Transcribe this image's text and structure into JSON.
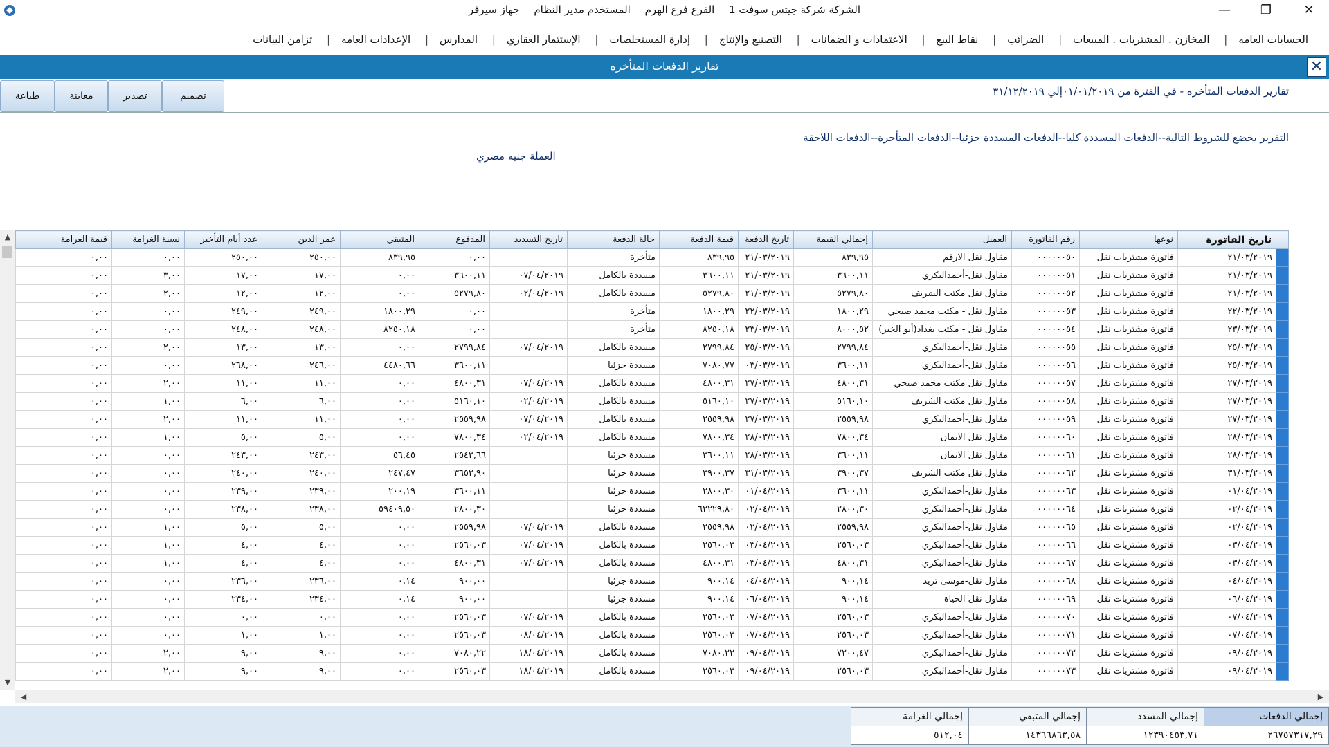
{
  "window": {
    "title_parts": [
      "الشركة شركة جيتس سوفت 1",
      "الفرع فرع الهرم",
      "المستخدم مدير النظام",
      "جهاز سيرفر"
    ],
    "minimize": "—",
    "restore": "❐",
    "close": "✕"
  },
  "menu": [
    "الحسابات العامه",
    "المخازن . المشتريات . المبيعات",
    "الضرائب",
    "نقاط البيع",
    "الاعتمادات و الضمانات",
    "التصنيع والإنتاج",
    "إدارة المستخلصات",
    "الإستثمار العقاري",
    "المدارس",
    "الإعدادات العامه",
    "تزامن البيانات"
  ],
  "report": {
    "header_title": "تقارير الدفعات المتأخره",
    "close_label": "✕",
    "period_text": "تقارير الدفعات المتأخره -    في الفترة من ٠١/٠١/٢٠١٩إلي ٣١/١٢/٢٠١٩",
    "conditions_text": "التقرير يخضع للشروط التالية--الدفعات المسددة كليا--الدفعات المسددة جزئيا--الدفعات المتأخرة--الدفعات اللاحقة",
    "currency_text": "العملة جنيه مصري"
  },
  "buttons": {
    "design": "تصميم",
    "export": "تصدير",
    "preview": "معاينة",
    "print": "طباعة"
  },
  "scroll": {
    "up": "▲",
    "down": "▼",
    "left": "◀",
    "right": "▶"
  },
  "grid": {
    "columns": [
      "تاريخ الفاتورة",
      "نوعها",
      "رقم الفاتورة",
      "العميل",
      "إجمالي القيمة",
      "تاريخ الدفعة",
      "قيمة الدفعة",
      "حالة الدفعة",
      "تاريخ التسديد",
      "المدفوع",
      "المتبقي",
      "عمر الدين",
      "عدد أيام التأخير",
      "نسبة الغرامة",
      "قيمة الغرامة"
    ],
    "rows": [
      [
        "٢١/٠٣/٢٠١٩",
        "فاتورة مشتريات نقل",
        "٠٠٠٠٠٠٥٠",
        "مقاول نقل الارقم",
        "٨٣٩,٩٥",
        "٢١/٠٣/٢٠١٩",
        "٨٣٩,٩٥",
        "متأخرة",
        "",
        "٠,٠٠",
        "٨٣٩,٩٥",
        "٢٥٠,٠٠",
        "٢٥٠,٠٠",
        "٠,٠٠",
        "٠,٠٠"
      ],
      [
        "٢١/٠٣/٢٠١٩",
        "فاتورة مشتريات نقل",
        "٠٠٠٠٠٠٥١",
        "مقاول نقل-أحمدالبكري",
        "٣٦٠٠,١١",
        "٢١/٠٣/٢٠١٩",
        "٣٦٠٠,١١",
        "مسددة بالكامل",
        "٠٧/٠٤/٢٠١٩",
        "٣٦٠٠,١١",
        "٠,٠٠",
        "١٧,٠٠",
        "١٧,٠٠",
        "٣,٠٠",
        "٠,٠٠"
      ],
      [
        "٢١/٠٣/٢٠١٩",
        "فاتورة مشتريات نقل",
        "٠٠٠٠٠٠٥٢",
        "مقاول نقل مكتب الشريف",
        "٥٢٧٩,٨٠",
        "٢١/٠٣/٢٠١٩",
        "٥٢٧٩,٨٠",
        "مسددة بالكامل",
        "٠٢/٠٤/٢٠١٩",
        "٥٢٧٩,٨٠",
        "٠,٠٠",
        "١٢,٠٠",
        "١٢,٠٠",
        "٢,٠٠",
        "٠,٠٠"
      ],
      [
        "٢٢/٠٣/٢٠١٩",
        "فاتورة مشتريات نقل",
        "٠٠٠٠٠٠٥٣",
        "مقاول نقل - مكتب محمد صبحي",
        "١٨٠٠,٢٩",
        "٢٢/٠٣/٢٠١٩",
        "١٨٠٠,٢٩",
        "متأخرة",
        "",
        "٠,٠٠",
        "١٨٠٠,٢٩",
        "٢٤٩,٠٠",
        "٢٤٩,٠٠",
        "٠,٠٠",
        "٠,٠٠"
      ],
      [
        "٢٣/٠٣/٢٠١٩",
        "فاتورة مشتريات نقل",
        "٠٠٠٠٠٠٥٤",
        "مقاول نقل - مكتب بغداد(أبو الخير)",
        "٨٠٠٠,٥٢",
        "٢٣/٠٣/٢٠١٩",
        "٨٢٥٠,١٨",
        "متأخرة",
        "",
        "٠,٠٠",
        "٨٢٥٠,١٨",
        "٢٤٨,٠٠",
        "٢٤٨,٠٠",
        "٠,٠٠",
        "٠,٠٠"
      ],
      [
        "٢٥/٠٣/٢٠١٩",
        "فاتورة مشتريات نقل",
        "٠٠٠٠٠٠٥٥",
        "مقاول نقل-أحمدالبكري",
        "٢٧٩٩,٨٤",
        "٢٥/٠٣/٢٠١٩",
        "٢٧٩٩,٨٤",
        "مسددة بالكامل",
        "٠٧/٠٤/٢٠١٩",
        "٢٧٩٩,٨٤",
        "٠,٠٠",
        "١٣,٠٠",
        "١٣,٠٠",
        "٢,٠٠",
        "٠,٠٠"
      ],
      [
        "٢٥/٠٣/٢٠١٩",
        "فاتورة مشتريات نقل",
        "٠٠٠٠٠٠٥٦",
        "مقاول نقل-أحمدالبكري",
        "٣٦٠٠,١١",
        "٠٣/٠٣/٢٠١٩",
        "٧٠٨٠,٧٧",
        "مسددة جزئيا",
        "",
        "٣٦٠٠,١١",
        "٤٤٨٠,٦٦",
        "٢٤٦,٠٠",
        "٢٦٨,٠٠",
        "٠,٠٠",
        "٠,٠٠"
      ],
      [
        "٢٧/٠٣/٢٠١٩",
        "فاتورة مشتريات نقل",
        "٠٠٠٠٠٠٥٧",
        "مقاول نقل مكتب محمد صبحي",
        "٤٨٠٠,٣١",
        "٢٧/٠٣/٢٠١٩",
        "٤٨٠٠,٣١",
        "مسددة بالكامل",
        "٠٧/٠٤/٢٠١٩",
        "٤٨٠٠,٣١",
        "٠,٠٠",
        "١١,٠٠",
        "١١,٠٠",
        "٢,٠٠",
        "٠,٠٠"
      ],
      [
        "٢٧/٠٣/٢٠١٩",
        "فاتورة مشتريات نقل",
        "٠٠٠٠٠٠٥٨",
        "مقاول نقل مكتب الشريف",
        "٥١٦٠,١٠",
        "٢٧/٠٣/٢٠١٩",
        "٥١٦٠,١٠",
        "مسددة بالكامل",
        "٠٢/٠٤/٢٠١٩",
        "٥١٦٠,١٠",
        "٠,٠٠",
        "٦,٠٠",
        "٦,٠٠",
        "١,٠٠",
        "٠,٠٠"
      ],
      [
        "٢٧/٠٣/٢٠١٩",
        "فاتورة مشتريات نقل",
        "٠٠٠٠٠٠٥٩",
        "مقاول نقل-أحمدالبكري",
        "٢٥٥٩,٩٨",
        "٢٧/٠٣/٢٠١٩",
        "٢٥٥٩,٩٨",
        "مسددة بالكامل",
        "٠٧/٠٤/٢٠١٩",
        "٢٥٥٩,٩٨",
        "٠,٠٠",
        "١١,٠٠",
        "١١,٠٠",
        "٢,٠٠",
        "٠,٠٠"
      ],
      [
        "٢٨/٠٣/٢٠١٩",
        "فاتورة مشتريات نقل",
        "٠٠٠٠٠٠٦٠",
        "مقاول نقل الايمان",
        "٧٨٠٠,٣٤",
        "٢٨/٠٣/٢٠١٩",
        "٧٨٠٠,٣٤",
        "مسددة بالكامل",
        "٠٢/٠٤/٢٠١٩",
        "٧٨٠٠,٣٤",
        "٠,٠٠",
        "٥,٠٠",
        "٥,٠٠",
        "١,٠٠",
        "٠,٠٠"
      ],
      [
        "٢٨/٠٣/٢٠١٩",
        "فاتورة مشتريات نقل",
        "٠٠٠٠٠٠٦١",
        "مقاول نقل الايمان",
        "٣٦٠٠,١١",
        "٢٨/٠٣/٢٠١٩",
        "٣٦٠٠,١١",
        "مسددة جزئيا",
        "",
        "٢٥٤٣,٦٦",
        "٥٦,٤٥",
        "٢٤٣,٠٠",
        "٢٤٣,٠٠",
        "٠,٠٠",
        "٠,٠٠"
      ],
      [
        "٣١/٠٣/٢٠١٩",
        "فاتورة مشتريات نقل",
        "٠٠٠٠٠٠٦٢",
        "مقاول نقل مكتب الشريف",
        "٣٩٠٠,٣٧",
        "٣١/٠٣/٢٠١٩",
        "٣٩٠٠,٣٧",
        "مسددة جزئيا",
        "",
        "٣٦٥٢,٩٠",
        "٢٤٧,٤٧",
        "٢٤٠,٠٠",
        "٢٤٠,٠٠",
        "٠,٠٠",
        "٠,٠٠"
      ],
      [
        "٠١/٠٤/٢٠١٩",
        "فاتورة مشتريات نقل",
        "٠٠٠٠٠٠٦٣",
        "مقاول نقل-أحمدالبكري",
        "٣٦٠٠,١١",
        "٠١/٠٤/٢٠١٩",
        "٢٨٠٠,٣٠",
        "مسددة جزئيا",
        "",
        "٣٦٠٠,١١",
        "٢٠٠,١٩",
        "٢٣٩,٠٠",
        "٢٣٩,٠٠",
        "٠,٠٠",
        "٠,٠٠"
      ],
      [
        "٠٢/٠٤/٢٠١٩",
        "فاتورة مشتريات نقل",
        "٠٠٠٠٠٠٦٤",
        "مقاول نقل-أحمدالبكري",
        "٢٨٠٠,٣٠",
        "٠٢/٠٤/٢٠١٩",
        "٦٢٢٢٩,٨٠",
        "مسددة جزئيا",
        "",
        "٢٨٠٠,٣٠",
        "٥٩٤٠٩,٥٠",
        "٢٣٨,٠٠",
        "٢٣٨,٠٠",
        "٠,٠٠",
        "٠,٠٠"
      ],
      [
        "٠٢/٠٤/٢٠١٩",
        "فاتورة مشتريات نقل",
        "٠٠٠٠٠٠٦٥",
        "مقاول نقل-أحمدالبكري",
        "٢٥٥٩,٩٨",
        "٠٢/٠٤/٢٠١٩",
        "٢٥٥٩,٩٨",
        "مسددة بالكامل",
        "٠٧/٠٤/٢٠١٩",
        "٢٥٥٩,٩٨",
        "٠,٠٠",
        "٥,٠٠",
        "٥,٠٠",
        "١,٠٠",
        "٠,٠٠"
      ],
      [
        "٠٣/٠٤/٢٠١٩",
        "فاتورة مشتريات نقل",
        "٠٠٠٠٠٠٦٦",
        "مقاول نقل-أحمدالبكري",
        "٢٥٦٠,٠٣",
        "٠٣/٠٤/٢٠١٩",
        "٢٥٦٠,٠٣",
        "مسددة بالكامل",
        "٠٧/٠٤/٢٠١٩",
        "٢٥٦٠,٠٣",
        "٠,٠٠",
        "٤,٠٠",
        "٤,٠٠",
        "١,٠٠",
        "٠,٠٠"
      ],
      [
        "٠٣/٠٤/٢٠١٩",
        "فاتورة مشتريات نقل",
        "٠٠٠٠٠٠٦٧",
        "مقاول نقل-أحمدالبكري",
        "٤٨٠٠,٣١",
        "٠٣/٠٤/٢٠١٩",
        "٤٨٠٠,٣١",
        "مسددة بالكامل",
        "٠٧/٠٤/٢٠١٩",
        "٤٨٠٠,٣١",
        "٠,٠٠",
        "٤,٠٠",
        "٤,٠٠",
        "١,٠٠",
        "٠,٠٠"
      ],
      [
        "٠٤/٠٤/٢٠١٩",
        "فاتورة مشتريات نقل",
        "٠٠٠٠٠٠٦٨",
        "مقاول نقل-موسى تريد",
        "٩٠٠,١٤",
        "٠٤/٠٤/٢٠١٩",
        "٩٠٠,١٤",
        "مسددة جزئيا",
        "",
        "٩٠٠,٠٠",
        "٠,١٤",
        "٢٣٦,٠٠",
        "٢٣٦,٠٠",
        "٠,٠٠",
        "٠,٠٠"
      ],
      [
        "٠٦/٠٤/٢٠١٩",
        "فاتورة مشتريات نقل",
        "٠٠٠٠٠٠٦٩",
        "مقاول نقل الحياة",
        "٩٠٠,١٤",
        "٠٦/٠٤/٢٠١٩",
        "٩٠٠,١٤",
        "مسددة جزئيا",
        "",
        "٩٠٠,٠٠",
        "٠,١٤",
        "٢٣٤,٠٠",
        "٢٣٤,٠٠",
        "٠,٠٠",
        "٠,٠٠"
      ],
      [
        "٠٧/٠٤/٢٠١٩",
        "فاتورة مشتريات نقل",
        "٠٠٠٠٠٠٧٠",
        "مقاول نقل-أحمدالبكري",
        "٢٥٦٠,٠٣",
        "٠٧/٠٤/٢٠١٩",
        "٢٥٦٠,٠٣",
        "مسددة بالكامل",
        "٠٧/٠٤/٢٠١٩",
        "٢٥٦٠,٠٣",
        "٠,٠٠",
        "٠,٠٠",
        "٠,٠٠",
        "٠,٠٠",
        "٠,٠٠"
      ],
      [
        "٠٧/٠٤/٢٠١٩",
        "فاتورة مشتريات نقل",
        "٠٠٠٠٠٠٧١",
        "مقاول نقل-أحمدالبكري",
        "٢٥٦٠,٠٣",
        "٠٧/٠٤/٢٠١٩",
        "٢٥٦٠,٠٣",
        "مسددة بالكامل",
        "٠٨/٠٤/٢٠١٩",
        "٢٥٦٠,٠٣",
        "٠,٠٠",
        "١,٠٠",
        "١,٠٠",
        "٠,٠٠",
        "٠,٠٠"
      ],
      [
        "٠٩/٠٤/٢٠١٩",
        "فاتورة مشتريات نقل",
        "٠٠٠٠٠٠٧٢",
        "مقاول نقل-أحمدالبكري",
        "٧٢٠٠,٤٧",
        "٠٩/٠٤/٢٠١٩",
        "٧٠٨٠,٢٢",
        "مسددة بالكامل",
        "١٨/٠٤/٢٠١٩",
        "٧٠٨٠,٢٢",
        "٠,٠٠",
        "٩,٠٠",
        "٩,٠٠",
        "٢,٠٠",
        "٠,٠٠"
      ],
      [
        "٠٩/٠٤/٢٠١٩",
        "فاتورة مشتريات نقل",
        "٠٠٠٠٠٠٧٣",
        "مقاول نقل-أحمدالبكري",
        "٢٥٦٠,٠٣",
        "٠٩/٠٤/٢٠١٩",
        "٢٥٦٠,٠٣",
        "مسددة بالكامل",
        "١٨/٠٤/٢٠١٩",
        "٢٥٦٠,٠٣",
        "٠,٠٠",
        "٩,٠٠",
        "٩,٠٠",
        "٢,٠٠",
        "٠,٠٠"
      ]
    ]
  },
  "totals": {
    "labels": [
      "إجمالي الدفعات",
      "إجمالي المسدد",
      "إجمالي المتبقي",
      "إجمالي الغرامة"
    ],
    "values": [
      "٢٦٧٥٧٣١٧,٢٩",
      "١٢٣٩٠٤٥٣,٧١",
      "١٤٣٦٦٨٦٣,٥٨",
      "٥١٢,٠٤"
    ]
  }
}
